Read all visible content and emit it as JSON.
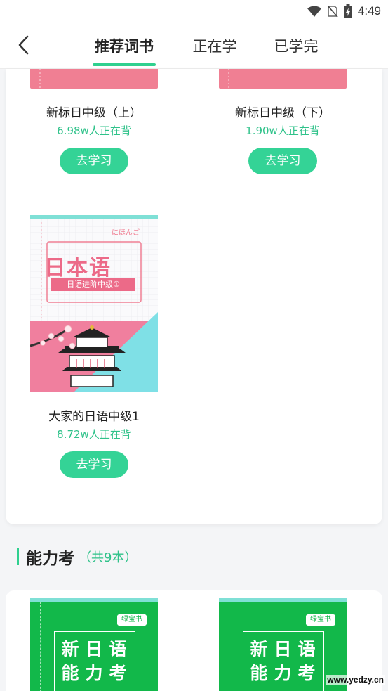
{
  "status_bar": {
    "time": "4:49"
  },
  "header": {
    "tabs": [
      {
        "label": "推荐词书",
        "active": true
      },
      {
        "label": "正在学",
        "active": false
      },
      {
        "label": "已学完",
        "active": false
      }
    ]
  },
  "books_top": [
    {
      "title": "新标日中级（上）",
      "count": "6.98w人正在背",
      "button": "去学习"
    },
    {
      "title": "新标日中级（下）",
      "count": "1.90w人正在背",
      "button": "去学习"
    }
  ],
  "book_featured": {
    "title": "大家的日语中级1",
    "count": "8.72w人正在背",
    "button": "去学习",
    "cover": {
      "kana": "にほんご",
      "main": "日本语",
      "sub": "日语进阶中级①"
    }
  },
  "section": {
    "title": "能力考",
    "count": "（共9本）"
  },
  "green_books": [
    {
      "badge": "绿宝书",
      "chars": [
        "新",
        "日",
        "语",
        "能",
        "力",
        "考"
      ]
    },
    {
      "badge": "绿宝书",
      "chars": [
        "新",
        "日",
        "语",
        "能",
        "力",
        "考"
      ]
    }
  ],
  "watermark": "www.yedzy.cn",
  "colors": {
    "accent": "#2fd08f",
    "count_text": "#2fc28a",
    "button_bg": "#34d396",
    "pink": "#f07f93",
    "teal": "#7fe0dc",
    "green_book": "#12b84a"
  }
}
